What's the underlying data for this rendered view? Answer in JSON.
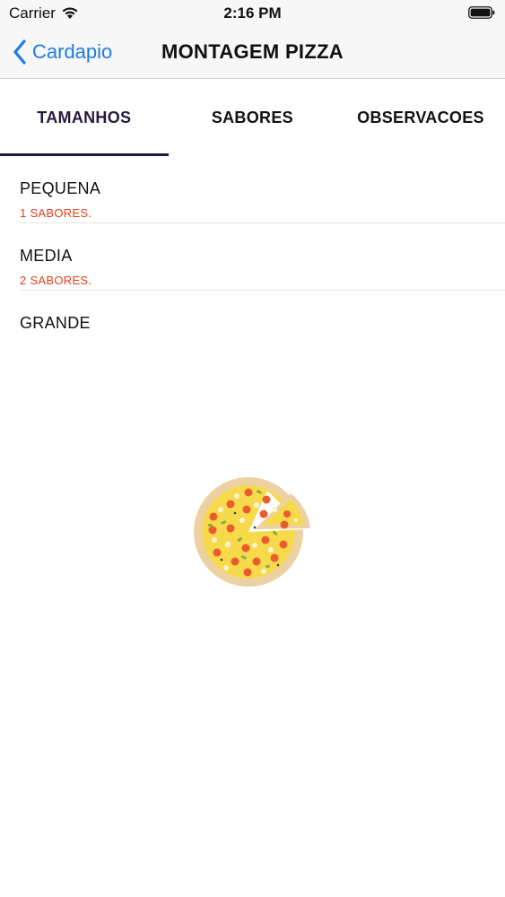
{
  "status_bar": {
    "carrier": "Carrier",
    "time": "2:16 PM"
  },
  "nav": {
    "back_label": "Cardapio",
    "title": "MONTAGEM PIZZA"
  },
  "tabs": [
    {
      "label": "TAMANHOS",
      "active": true
    },
    {
      "label": "SABORES",
      "active": false
    },
    {
      "label": "OBSERVACOES",
      "active": false
    }
  ],
  "sizes": [
    {
      "title": "PEQUENA",
      "subtitle": "1 SABORES."
    },
    {
      "title": "MEDIA",
      "subtitle": "2 SABORES."
    },
    {
      "title": "GRANDE",
      "subtitle": ""
    }
  ],
  "colors": {
    "accent": "#1e7be6",
    "tab_indicator": "#20183a",
    "subtitle": "#e2401c"
  },
  "icons": {
    "loading": "pizza-icon"
  }
}
